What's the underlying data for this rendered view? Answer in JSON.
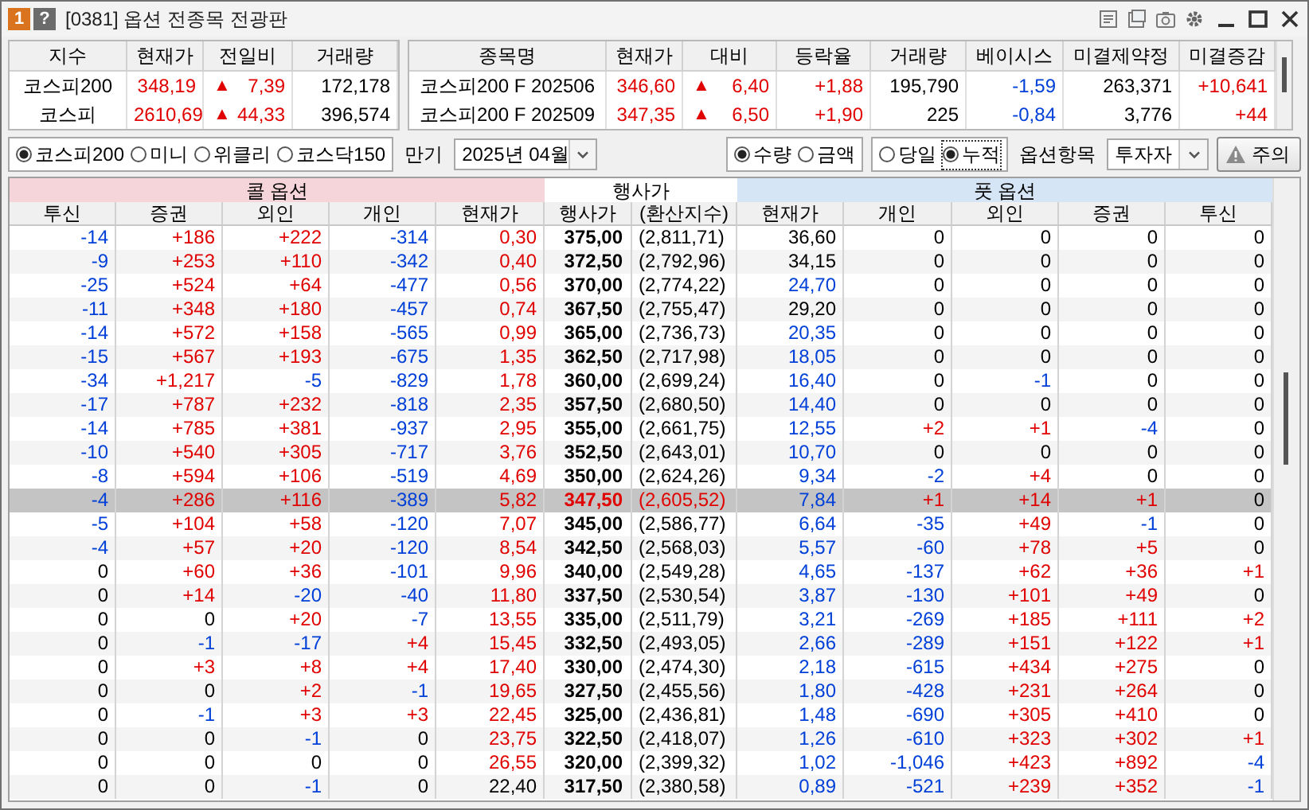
{
  "window": {
    "title": "[0381] 옵션 전종목 전광판",
    "badges": [
      "1",
      "?"
    ]
  },
  "index_table": {
    "columns": [
      "지수",
      "현재가",
      "전일비",
      "거래량"
    ],
    "rows": [
      {
        "cells": [
          {
            "text": "코스피200",
            "color": "#000000"
          },
          {
            "text": "348,19",
            "color": "#e00000"
          },
          {
            "arrow": "▲",
            "text": "7,39",
            "color": "#e00000"
          },
          {
            "text": "172,178",
            "color": "#000000"
          }
        ]
      },
      {
        "cells": [
          {
            "text": "코스피",
            "color": "#000000"
          },
          {
            "text": "2610,69",
            "color": "#e00000"
          },
          {
            "arrow": "▲",
            "text": "44,33",
            "color": "#e00000"
          },
          {
            "text": "396,574",
            "color": "#000000"
          }
        ]
      }
    ]
  },
  "futures_table": {
    "columns": [
      "종목명",
      "현재가",
      "대비",
      "등락율",
      "거래량",
      "베이시스",
      "미결제약정",
      "미결증감"
    ],
    "rows": [
      {
        "cells": [
          {
            "text": "코스피200 F 202506",
            "color": "#000000"
          },
          {
            "text": "346,60",
            "color": "#e00000"
          },
          {
            "arrow": "▲",
            "text": "6,40",
            "color": "#e00000"
          },
          {
            "text": "+1,88",
            "color": "#e00000"
          },
          {
            "text": "195,790",
            "color": "#000000"
          },
          {
            "text": "-1,59",
            "color": "#0040d8"
          },
          {
            "text": "263,371",
            "color": "#000000"
          },
          {
            "text": "+10,641",
            "color": "#e00000"
          }
        ]
      },
      {
        "cells": [
          {
            "text": "코스피200 F 202509",
            "color": "#000000"
          },
          {
            "text": "347,35",
            "color": "#e00000"
          },
          {
            "arrow": "▲",
            "text": "6,50",
            "color": "#e00000"
          },
          {
            "text": "+1,90",
            "color": "#e00000"
          },
          {
            "text": "225",
            "color": "#000000"
          },
          {
            "text": "-0,84",
            "color": "#0040d8"
          },
          {
            "text": "3,776",
            "color": "#000000"
          },
          {
            "text": "+44",
            "color": "#e00000"
          }
        ]
      }
    ]
  },
  "market_radios": [
    {
      "label": "코스피200",
      "selected": true
    },
    {
      "label": "미니",
      "selected": false
    },
    {
      "label": "위클리",
      "selected": false
    },
    {
      "label": "코스닥150",
      "selected": false
    }
  ],
  "expiry": {
    "label": "만기",
    "value": "2025년 04월"
  },
  "unit_radios": [
    {
      "label": "수량",
      "selected": true
    },
    {
      "label": "금액",
      "selected": false
    }
  ],
  "period_radios": [
    {
      "label": "당일",
      "selected": false
    },
    {
      "label": "누적",
      "selected": true
    }
  ],
  "item_select": {
    "label": "옵션항목",
    "value": "투자자"
  },
  "warning_button": {
    "label": "주의"
  },
  "board": {
    "groups": [
      {
        "label": "콜 옵션",
        "kind": "call"
      },
      {
        "label": "행사가",
        "kind": "strike"
      },
      {
        "label": "풋 옵션",
        "kind": "put"
      }
    ],
    "columns": [
      "투신",
      "증권",
      "외인",
      "개인",
      "현재가",
      "행사가",
      "(환산지수)",
      "현재가",
      "개인",
      "외인",
      "증권",
      "투신"
    ],
    "rows": [
      {
        "selected": false,
        "call": [
          {
            "text": "-14",
            "color": "#0040d8"
          },
          {
            "text": "+186",
            "color": "#e00000"
          },
          {
            "text": "+222",
            "color": "#e00000"
          },
          {
            "text": "-314",
            "color": "#0040d8"
          },
          {
            "text": "0,30",
            "color": "#e00000"
          }
        ],
        "strike": "375,00",
        "index": "(2,811,71)",
        "put": [
          {
            "text": "36,60",
            "color": "#000000"
          },
          {
            "text": "0",
            "color": "#000000"
          },
          {
            "text": "0",
            "color": "#000000"
          },
          {
            "text": "0",
            "color": "#000000"
          },
          {
            "text": "0",
            "color": "#000000"
          }
        ]
      },
      {
        "selected": false,
        "call": [
          {
            "text": "-9",
            "color": "#0040d8"
          },
          {
            "text": "+253",
            "color": "#e00000"
          },
          {
            "text": "+110",
            "color": "#e00000"
          },
          {
            "text": "-342",
            "color": "#0040d8"
          },
          {
            "text": "0,40",
            "color": "#e00000"
          }
        ],
        "strike": "372,50",
        "index": "(2,792,96)",
        "put": [
          {
            "text": "34,15",
            "color": "#000000"
          },
          {
            "text": "0",
            "color": "#000000"
          },
          {
            "text": "0",
            "color": "#000000"
          },
          {
            "text": "0",
            "color": "#000000"
          },
          {
            "text": "0",
            "color": "#000000"
          }
        ]
      },
      {
        "selected": false,
        "call": [
          {
            "text": "-25",
            "color": "#0040d8"
          },
          {
            "text": "+524",
            "color": "#e00000"
          },
          {
            "text": "+64",
            "color": "#e00000"
          },
          {
            "text": "-477",
            "color": "#0040d8"
          },
          {
            "text": "0,56",
            "color": "#e00000"
          }
        ],
        "strike": "370,00",
        "index": "(2,774,22)",
        "put": [
          {
            "text": "24,70",
            "color": "#0040d8"
          },
          {
            "text": "0",
            "color": "#000000"
          },
          {
            "text": "0",
            "color": "#000000"
          },
          {
            "text": "0",
            "color": "#000000"
          },
          {
            "text": "0",
            "color": "#000000"
          }
        ]
      },
      {
        "selected": false,
        "call": [
          {
            "text": "-11",
            "color": "#0040d8"
          },
          {
            "text": "+348",
            "color": "#e00000"
          },
          {
            "text": "+180",
            "color": "#e00000"
          },
          {
            "text": "-457",
            "color": "#0040d8"
          },
          {
            "text": "0,74",
            "color": "#e00000"
          }
        ],
        "strike": "367,50",
        "index": "(2,755,47)",
        "put": [
          {
            "text": "29,20",
            "color": "#000000"
          },
          {
            "text": "0",
            "color": "#000000"
          },
          {
            "text": "0",
            "color": "#000000"
          },
          {
            "text": "0",
            "color": "#000000"
          },
          {
            "text": "0",
            "color": "#000000"
          }
        ]
      },
      {
        "selected": false,
        "call": [
          {
            "text": "-14",
            "color": "#0040d8"
          },
          {
            "text": "+572",
            "color": "#e00000"
          },
          {
            "text": "+158",
            "color": "#e00000"
          },
          {
            "text": "-565",
            "color": "#0040d8"
          },
          {
            "text": "0,99",
            "color": "#e00000"
          }
        ],
        "strike": "365,00",
        "index": "(2,736,73)",
        "put": [
          {
            "text": "20,35",
            "color": "#0040d8"
          },
          {
            "text": "0",
            "color": "#000000"
          },
          {
            "text": "0",
            "color": "#000000"
          },
          {
            "text": "0",
            "color": "#000000"
          },
          {
            "text": "0",
            "color": "#000000"
          }
        ]
      },
      {
        "selected": false,
        "call": [
          {
            "text": "-15",
            "color": "#0040d8"
          },
          {
            "text": "+567",
            "color": "#e00000"
          },
          {
            "text": "+193",
            "color": "#e00000"
          },
          {
            "text": "-675",
            "color": "#0040d8"
          },
          {
            "text": "1,35",
            "color": "#e00000"
          }
        ],
        "strike": "362,50",
        "index": "(2,717,98)",
        "put": [
          {
            "text": "18,05",
            "color": "#0040d8"
          },
          {
            "text": "0",
            "color": "#000000"
          },
          {
            "text": "0",
            "color": "#000000"
          },
          {
            "text": "0",
            "color": "#000000"
          },
          {
            "text": "0",
            "color": "#000000"
          }
        ]
      },
      {
        "selected": false,
        "call": [
          {
            "text": "-34",
            "color": "#0040d8"
          },
          {
            "text": "+1,217",
            "color": "#e00000"
          },
          {
            "text": "-5",
            "color": "#0040d8"
          },
          {
            "text": "-829",
            "color": "#0040d8"
          },
          {
            "text": "1,78",
            "color": "#e00000"
          }
        ],
        "strike": "360,00",
        "index": "(2,699,24)",
        "put": [
          {
            "text": "16,40",
            "color": "#0040d8"
          },
          {
            "text": "0",
            "color": "#000000"
          },
          {
            "text": "-1",
            "color": "#0040d8"
          },
          {
            "text": "0",
            "color": "#000000"
          },
          {
            "text": "0",
            "color": "#000000"
          }
        ]
      },
      {
        "selected": false,
        "call": [
          {
            "text": "-17",
            "color": "#0040d8"
          },
          {
            "text": "+787",
            "color": "#e00000"
          },
          {
            "text": "+232",
            "color": "#e00000"
          },
          {
            "text": "-818",
            "color": "#0040d8"
          },
          {
            "text": "2,35",
            "color": "#e00000"
          }
        ],
        "strike": "357,50",
        "index": "(2,680,50)",
        "put": [
          {
            "text": "14,40",
            "color": "#0040d8"
          },
          {
            "text": "0",
            "color": "#000000"
          },
          {
            "text": "0",
            "color": "#000000"
          },
          {
            "text": "0",
            "color": "#000000"
          },
          {
            "text": "0",
            "color": "#000000"
          }
        ]
      },
      {
        "selected": false,
        "call": [
          {
            "text": "-14",
            "color": "#0040d8"
          },
          {
            "text": "+785",
            "color": "#e00000"
          },
          {
            "text": "+381",
            "color": "#e00000"
          },
          {
            "text": "-937",
            "color": "#0040d8"
          },
          {
            "text": "2,95",
            "color": "#e00000"
          }
        ],
        "strike": "355,00",
        "index": "(2,661,75)",
        "put": [
          {
            "text": "12,55",
            "color": "#0040d8"
          },
          {
            "text": "+2",
            "color": "#e00000"
          },
          {
            "text": "+1",
            "color": "#e00000"
          },
          {
            "text": "-4",
            "color": "#0040d8"
          },
          {
            "text": "0",
            "color": "#000000"
          }
        ]
      },
      {
        "selected": false,
        "call": [
          {
            "text": "-10",
            "color": "#0040d8"
          },
          {
            "text": "+540",
            "color": "#e00000"
          },
          {
            "text": "+305",
            "color": "#e00000"
          },
          {
            "text": "-717",
            "color": "#0040d8"
          },
          {
            "text": "3,76",
            "color": "#e00000"
          }
        ],
        "strike": "352,50",
        "index": "(2,643,01)",
        "put": [
          {
            "text": "10,70",
            "color": "#0040d8"
          },
          {
            "text": "0",
            "color": "#000000"
          },
          {
            "text": "0",
            "color": "#000000"
          },
          {
            "text": "0",
            "color": "#000000"
          },
          {
            "text": "0",
            "color": "#000000"
          }
        ]
      },
      {
        "selected": false,
        "call": [
          {
            "text": "-8",
            "color": "#0040d8"
          },
          {
            "text": "+594",
            "color": "#e00000"
          },
          {
            "text": "+106",
            "color": "#e00000"
          },
          {
            "text": "-519",
            "color": "#0040d8"
          },
          {
            "text": "4,69",
            "color": "#e00000"
          }
        ],
        "strike": "350,00",
        "index": "(2,624,26)",
        "put": [
          {
            "text": "9,34",
            "color": "#0040d8"
          },
          {
            "text": "-2",
            "color": "#0040d8"
          },
          {
            "text": "+4",
            "color": "#e00000"
          },
          {
            "text": "0",
            "color": "#000000"
          },
          {
            "text": "0",
            "color": "#000000"
          }
        ]
      },
      {
        "selected": true,
        "call": [
          {
            "text": "-4",
            "color": "#0040d8"
          },
          {
            "text": "+286",
            "color": "#e00000"
          },
          {
            "text": "+116",
            "color": "#e00000"
          },
          {
            "text": "-389",
            "color": "#0040d8"
          },
          {
            "text": "5,82",
            "color": "#e00000"
          }
        ],
        "strike": "347,50",
        "index": "(2,605,52)",
        "put": [
          {
            "text": "7,84",
            "color": "#0040d8"
          },
          {
            "text": "+1",
            "color": "#e00000"
          },
          {
            "text": "+14",
            "color": "#e00000"
          },
          {
            "text": "+1",
            "color": "#e00000"
          },
          {
            "text": "0",
            "color": "#000000"
          }
        ]
      },
      {
        "selected": false,
        "call": [
          {
            "text": "-5",
            "color": "#0040d8"
          },
          {
            "text": "+104",
            "color": "#e00000"
          },
          {
            "text": "+58",
            "color": "#e00000"
          },
          {
            "text": "-120",
            "color": "#0040d8"
          },
          {
            "text": "7,07",
            "color": "#e00000"
          }
        ],
        "strike": "345,00",
        "index": "(2,586,77)",
        "put": [
          {
            "text": "6,64",
            "color": "#0040d8"
          },
          {
            "text": "-35",
            "color": "#0040d8"
          },
          {
            "text": "+49",
            "color": "#e00000"
          },
          {
            "text": "-1",
            "color": "#0040d8"
          },
          {
            "text": "0",
            "color": "#000000"
          }
        ]
      },
      {
        "selected": false,
        "call": [
          {
            "text": "-4",
            "color": "#0040d8"
          },
          {
            "text": "+57",
            "color": "#e00000"
          },
          {
            "text": "+20",
            "color": "#e00000"
          },
          {
            "text": "-120",
            "color": "#0040d8"
          },
          {
            "text": "8,54",
            "color": "#e00000"
          }
        ],
        "strike": "342,50",
        "index": "(2,568,03)",
        "put": [
          {
            "text": "5,57",
            "color": "#0040d8"
          },
          {
            "text": "-60",
            "color": "#0040d8"
          },
          {
            "text": "+78",
            "color": "#e00000"
          },
          {
            "text": "+5",
            "color": "#e00000"
          },
          {
            "text": "0",
            "color": "#000000"
          }
        ]
      },
      {
        "selected": false,
        "call": [
          {
            "text": "0",
            "color": "#000000"
          },
          {
            "text": "+60",
            "color": "#e00000"
          },
          {
            "text": "+36",
            "color": "#e00000"
          },
          {
            "text": "-101",
            "color": "#0040d8"
          },
          {
            "text": "9,96",
            "color": "#e00000"
          }
        ],
        "strike": "340,00",
        "index": "(2,549,28)",
        "put": [
          {
            "text": "4,65",
            "color": "#0040d8"
          },
          {
            "text": "-137",
            "color": "#0040d8"
          },
          {
            "text": "+62",
            "color": "#e00000"
          },
          {
            "text": "+36",
            "color": "#e00000"
          },
          {
            "text": "+1",
            "color": "#e00000"
          }
        ]
      },
      {
        "selected": false,
        "call": [
          {
            "text": "0",
            "color": "#000000"
          },
          {
            "text": "+14",
            "color": "#e00000"
          },
          {
            "text": "-20",
            "color": "#0040d8"
          },
          {
            "text": "-40",
            "color": "#0040d8"
          },
          {
            "text": "11,80",
            "color": "#e00000"
          }
        ],
        "strike": "337,50",
        "index": "(2,530,54)",
        "put": [
          {
            "text": "3,87",
            "color": "#0040d8"
          },
          {
            "text": "-130",
            "color": "#0040d8"
          },
          {
            "text": "+101",
            "color": "#e00000"
          },
          {
            "text": "+49",
            "color": "#e00000"
          },
          {
            "text": "0",
            "color": "#000000"
          }
        ]
      },
      {
        "selected": false,
        "call": [
          {
            "text": "0",
            "color": "#000000"
          },
          {
            "text": "0",
            "color": "#000000"
          },
          {
            "text": "+20",
            "color": "#e00000"
          },
          {
            "text": "-7",
            "color": "#0040d8"
          },
          {
            "text": "13,55",
            "color": "#e00000"
          }
        ],
        "strike": "335,00",
        "index": "(2,511,79)",
        "put": [
          {
            "text": "3,21",
            "color": "#0040d8"
          },
          {
            "text": "-269",
            "color": "#0040d8"
          },
          {
            "text": "+185",
            "color": "#e00000"
          },
          {
            "text": "+111",
            "color": "#e00000"
          },
          {
            "text": "+2",
            "color": "#e00000"
          }
        ]
      },
      {
        "selected": false,
        "call": [
          {
            "text": "0",
            "color": "#000000"
          },
          {
            "text": "-1",
            "color": "#0040d8"
          },
          {
            "text": "-17",
            "color": "#0040d8"
          },
          {
            "text": "+4",
            "color": "#e00000"
          },
          {
            "text": "15,45",
            "color": "#e00000"
          }
        ],
        "strike": "332,50",
        "index": "(2,493,05)",
        "put": [
          {
            "text": "2,66",
            "color": "#0040d8"
          },
          {
            "text": "-289",
            "color": "#0040d8"
          },
          {
            "text": "+151",
            "color": "#e00000"
          },
          {
            "text": "+122",
            "color": "#e00000"
          },
          {
            "text": "+1",
            "color": "#e00000"
          }
        ]
      },
      {
        "selected": false,
        "call": [
          {
            "text": "0",
            "color": "#000000"
          },
          {
            "text": "+3",
            "color": "#e00000"
          },
          {
            "text": "+8",
            "color": "#e00000"
          },
          {
            "text": "+4",
            "color": "#e00000"
          },
          {
            "text": "17,40",
            "color": "#e00000"
          }
        ],
        "strike": "330,00",
        "index": "(2,474,30)",
        "put": [
          {
            "text": "2,18",
            "color": "#0040d8"
          },
          {
            "text": "-615",
            "color": "#0040d8"
          },
          {
            "text": "+434",
            "color": "#e00000"
          },
          {
            "text": "+275",
            "color": "#e00000"
          },
          {
            "text": "0",
            "color": "#000000"
          }
        ]
      },
      {
        "selected": false,
        "call": [
          {
            "text": "0",
            "color": "#000000"
          },
          {
            "text": "0",
            "color": "#000000"
          },
          {
            "text": "+2",
            "color": "#e00000"
          },
          {
            "text": "-1",
            "color": "#0040d8"
          },
          {
            "text": "19,65",
            "color": "#e00000"
          }
        ],
        "strike": "327,50",
        "index": "(2,455,56)",
        "put": [
          {
            "text": "1,80",
            "color": "#0040d8"
          },
          {
            "text": "-428",
            "color": "#0040d8"
          },
          {
            "text": "+231",
            "color": "#e00000"
          },
          {
            "text": "+264",
            "color": "#e00000"
          },
          {
            "text": "0",
            "color": "#000000"
          }
        ]
      },
      {
        "selected": false,
        "call": [
          {
            "text": "0",
            "color": "#000000"
          },
          {
            "text": "-1",
            "color": "#0040d8"
          },
          {
            "text": "+3",
            "color": "#e00000"
          },
          {
            "text": "+3",
            "color": "#e00000"
          },
          {
            "text": "22,45",
            "color": "#e00000"
          }
        ],
        "strike": "325,00",
        "index": "(2,436,81)",
        "put": [
          {
            "text": "1,48",
            "color": "#0040d8"
          },
          {
            "text": "-690",
            "color": "#0040d8"
          },
          {
            "text": "+305",
            "color": "#e00000"
          },
          {
            "text": "+410",
            "color": "#e00000"
          },
          {
            "text": "0",
            "color": "#000000"
          }
        ]
      },
      {
        "selected": false,
        "call": [
          {
            "text": "0",
            "color": "#000000"
          },
          {
            "text": "0",
            "color": "#000000"
          },
          {
            "text": "-1",
            "color": "#0040d8"
          },
          {
            "text": "0",
            "color": "#000000"
          },
          {
            "text": "23,75",
            "color": "#e00000"
          }
        ],
        "strike": "322,50",
        "index": "(2,418,07)",
        "put": [
          {
            "text": "1,26",
            "color": "#0040d8"
          },
          {
            "text": "-610",
            "color": "#0040d8"
          },
          {
            "text": "+323",
            "color": "#e00000"
          },
          {
            "text": "+302",
            "color": "#e00000"
          },
          {
            "text": "+1",
            "color": "#e00000"
          }
        ]
      },
      {
        "selected": false,
        "call": [
          {
            "text": "0",
            "color": "#000000"
          },
          {
            "text": "0",
            "color": "#000000"
          },
          {
            "text": "0",
            "color": "#000000"
          },
          {
            "text": "0",
            "color": "#000000"
          },
          {
            "text": "26,55",
            "color": "#e00000"
          }
        ],
        "strike": "320,00",
        "index": "(2,399,32)",
        "put": [
          {
            "text": "1,02",
            "color": "#0040d8"
          },
          {
            "text": "-1,046",
            "color": "#0040d8"
          },
          {
            "text": "+423",
            "color": "#e00000"
          },
          {
            "text": "+892",
            "color": "#e00000"
          },
          {
            "text": "-4",
            "color": "#0040d8"
          }
        ]
      },
      {
        "selected": false,
        "call": [
          {
            "text": "0",
            "color": "#000000"
          },
          {
            "text": "0",
            "color": "#000000"
          },
          {
            "text": "-1",
            "color": "#0040d8"
          },
          {
            "text": "0",
            "color": "#000000"
          },
          {
            "text": "22,40",
            "color": "#000000"
          }
        ],
        "strike": "317,50",
        "index": "(2,380,58)",
        "put": [
          {
            "text": "0,89",
            "color": "#0040d8"
          },
          {
            "text": "-521",
            "color": "#0040d8"
          },
          {
            "text": "+239",
            "color": "#e00000"
          },
          {
            "text": "+352",
            "color": "#e00000"
          },
          {
            "text": "-1",
            "color": "#0040d8"
          }
        ]
      }
    ]
  }
}
